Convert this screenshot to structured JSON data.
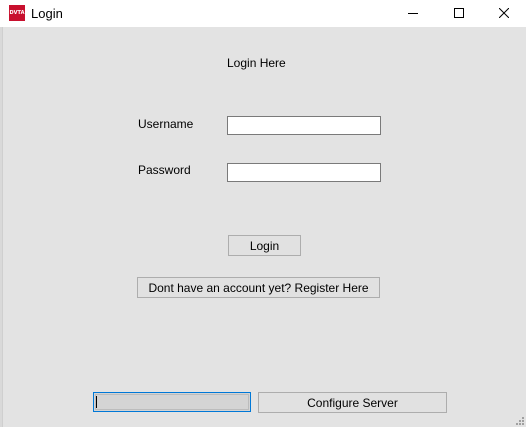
{
  "window": {
    "title": "Login",
    "app_icon_text": "DVTA",
    "controls": {
      "minimize_icon": "minimize-icon",
      "maximize_icon": "maximize-icon",
      "close_icon": "close-icon"
    }
  },
  "form": {
    "heading": "Login Here",
    "username_label": "Username",
    "username_value": "",
    "password_label": "Password",
    "password_value": "",
    "login_button": "Login",
    "register_button": "Dont have an account yet? Register Here"
  },
  "footer": {
    "status_value": "",
    "configure_button": "Configure Server"
  },
  "colors": {
    "background": "#e3e3e3",
    "titlebar": "#ffffff",
    "focus_border": "#0078d7",
    "app_icon": "#c8102e"
  }
}
